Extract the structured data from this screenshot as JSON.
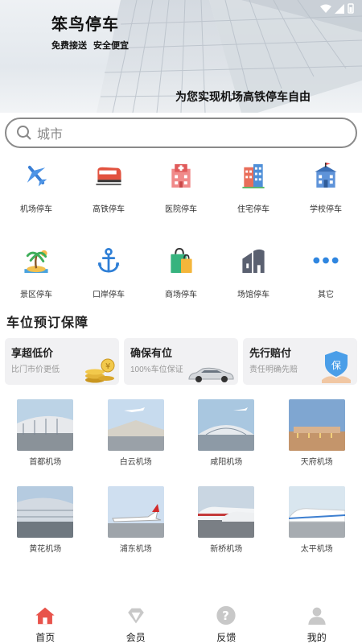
{
  "banner": {
    "brand": "笨鸟停车",
    "tagline_1": "免费接送",
    "tagline_2": "安全便宜",
    "slogan": "为您实现机场高铁停车自由"
  },
  "search": {
    "placeholder": "城市",
    "icon": "search-icon"
  },
  "categories": [
    {
      "label": "机场停车",
      "icon": "airplane-icon"
    },
    {
      "label": "高铁停车",
      "icon": "train-icon"
    },
    {
      "label": "医院停车",
      "icon": "hospital-icon"
    },
    {
      "label": "住宅停车",
      "icon": "residence-icon"
    },
    {
      "label": "学校停车",
      "icon": "school-icon"
    },
    {
      "label": "景区停车",
      "icon": "palm-island-icon"
    },
    {
      "label": "口岸停车",
      "icon": "anchor-icon"
    },
    {
      "label": "商场停车",
      "icon": "shopping-bag-icon"
    },
    {
      "label": "场馆停车",
      "icon": "venue-icon"
    },
    {
      "label": "其它",
      "icon": "more-dots-icon"
    }
  ],
  "section_title": "车位预订保障",
  "promos": [
    {
      "title": "享超低价",
      "subtitle": "比门市价更低",
      "icon": "coins-icon"
    },
    {
      "title": "确保有位",
      "subtitle": "100%车位保证",
      "icon": "car-icon"
    },
    {
      "title": "先行赔付",
      "subtitle": "责任明确先赔",
      "icon": "shield-hand-icon"
    }
  ],
  "airports": [
    {
      "label": "首都机场"
    },
    {
      "label": "白云机场"
    },
    {
      "label": "咸阳机场"
    },
    {
      "label": "天府机场"
    },
    {
      "label": "黄花机场"
    },
    {
      "label": "浦东机场"
    },
    {
      "label": "新桥机场"
    },
    {
      "label": "太平机场"
    }
  ],
  "tabs": [
    {
      "label": "首页",
      "icon": "home-icon",
      "active": true
    },
    {
      "label": "会员",
      "icon": "diamond-icon",
      "active": false
    },
    {
      "label": "反馈",
      "icon": "question-icon",
      "active": false
    },
    {
      "label": "我的",
      "icon": "user-icon",
      "active": false
    }
  ],
  "colors": {
    "accent": "#e8534b",
    "tab_inactive": "#c8c8c8",
    "search_border": "#8a8a8a"
  }
}
